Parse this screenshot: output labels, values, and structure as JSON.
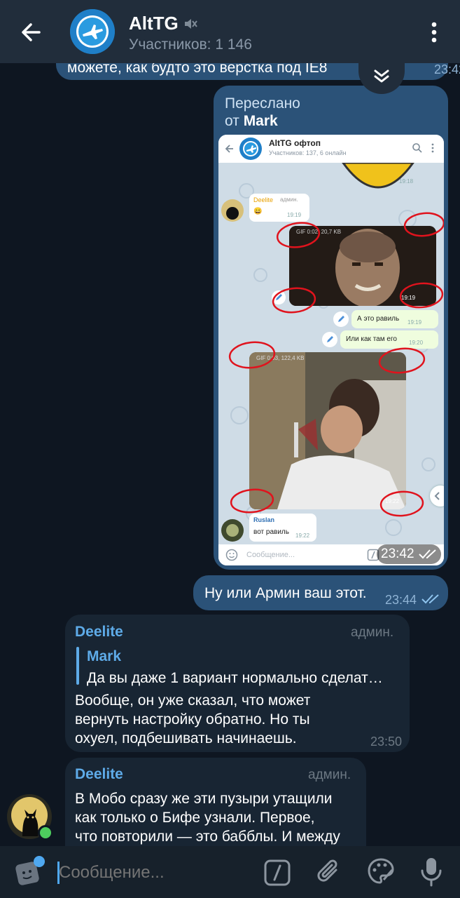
{
  "header": {
    "title": "AltTG",
    "subtitle": "Участников: 1 146"
  },
  "top_partial": {
    "text": "можете, как будто это верстка под IE8",
    "time": "23:42"
  },
  "forwarded": {
    "label_prefix": "Переслано",
    "label_from": "от",
    "author": "Mark",
    "time": "23:42",
    "screenshot": {
      "chat_title": "AltTG офтоп",
      "chat_subtitle": "Участников: 137, 6 онлайн",
      "t1": "19:18",
      "deelite_name": "Deelite",
      "deelite_role": "админ.",
      "deelite_emoji": "😄",
      "t2": "19:19",
      "gif1_info": "GIF 0:02, 20,7 KB",
      "gif1_time": "19:19",
      "msg_a": "А это равиль",
      "msg_a_time": "19:19",
      "msg_b": "Или как там его",
      "msg_b_time": "19:20",
      "gif2_info": "GIF 0:03, 122,4 KB",
      "gif2_time": "19:22",
      "ruslan_name": "Ruslan",
      "ruslan_text": "вот равиль",
      "ruslan_time": "19:22",
      "input_placeholder": "Сообщение..."
    }
  },
  "msg_armin": {
    "text": "Ну или Армин ваш этот.",
    "time": "23:44"
  },
  "msg_deelite1": {
    "name": "Deelite",
    "role": "админ.",
    "reply_name": "Mark",
    "reply_text": "Да вы даже 1 вариант нормально сделат…",
    "lines": [
      "Вообще, он уже сказал, что может",
      "вернуть настройку обратно. Но ты",
      "охуел, подбешивать начинаешь."
    ],
    "time": "23:50"
  },
  "msg_deelite2": {
    "name": "Deelite",
    "role": "админ.",
    "lines": [
      "В Мобо сразу же эти пузыри утащили",
      "как только о Бифе узнали. Первое,",
      "что повторили — это бабблы. И между"
    ]
  },
  "input": {
    "placeholder": "Сообщение..."
  },
  "colors": {
    "background": "#0e1621",
    "header": "#212d3b",
    "outgoing": "#2b5278",
    "incoming": "#182533",
    "accent": "#5eabe8"
  }
}
